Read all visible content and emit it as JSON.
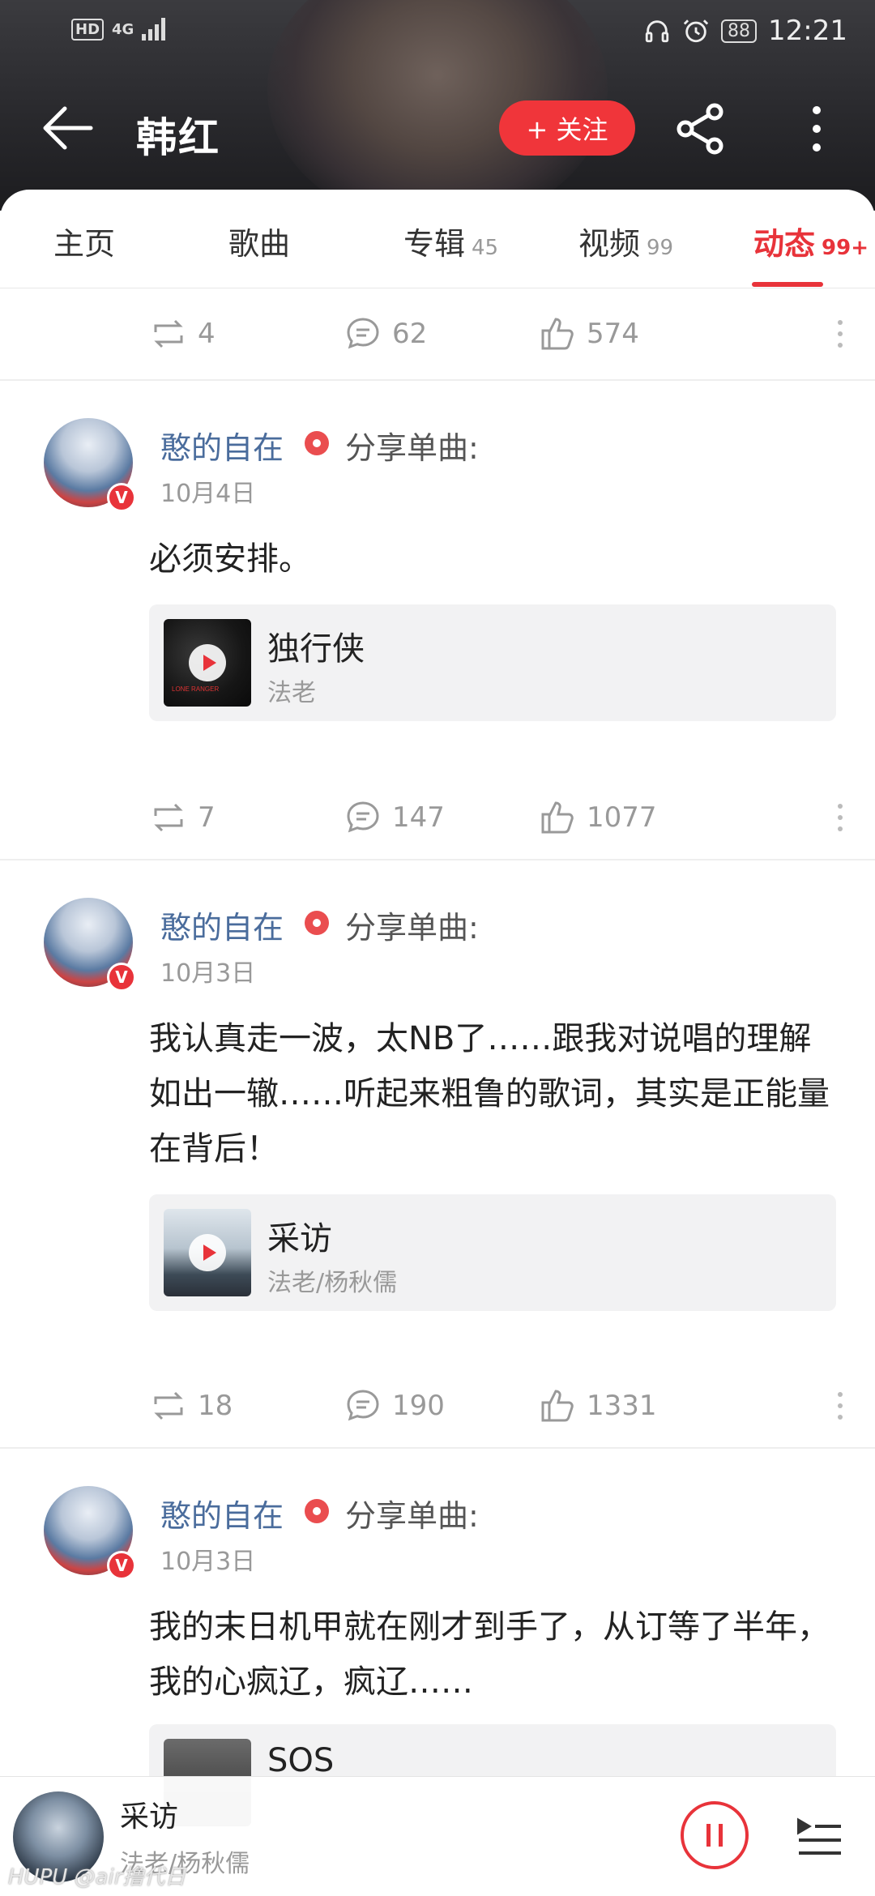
{
  "status": {
    "network": "HD",
    "signal": "4G",
    "battery": "88",
    "time": "12:21"
  },
  "header": {
    "title": "韩红",
    "follow_label": "+ 关注"
  },
  "tabs": [
    {
      "label": "主页",
      "count": ""
    },
    {
      "label": "歌曲",
      "count": ""
    },
    {
      "label": "专辑",
      "count": "45"
    },
    {
      "label": "视频",
      "count": "99"
    },
    {
      "label": "动态",
      "count": "99+"
    }
  ],
  "top_actions": {
    "repost": "4",
    "comment": "62",
    "like": "574"
  },
  "posts": [
    {
      "user": "憨的自在",
      "share_label": "分享单曲:",
      "date": "10月4日",
      "text": "必须安排。",
      "song": {
        "title": "独行侠",
        "artist": "法老",
        "cover_text": "LONE RANGER"
      },
      "repost": "7",
      "comment": "147",
      "like": "1077"
    },
    {
      "user": "憨的自在",
      "share_label": "分享单曲:",
      "date": "10月3日",
      "text": "我认真走一波，太NB了……跟我对说唱的理解如出一辙……听起来粗鲁的歌词，其实是正能量在背后！",
      "song": {
        "title": "采访",
        "artist": "法老/杨秋儒"
      },
      "repost": "18",
      "comment": "190",
      "like": "1331"
    },
    {
      "user": "憨的自在",
      "share_label": "分享单曲:",
      "date": "10月3日",
      "text": "我的末日机甲就在刚才到手了，从订等了半年，我的心疯辽，疯辽……",
      "song": {
        "title": "SOS",
        "artist": ""
      }
    }
  ],
  "player": {
    "title": "采访",
    "artist": "法老/杨秋儒"
  },
  "watermark": "HUPU @air撸代日",
  "colors": {
    "accent": "#e8333a",
    "username": "#4a6c9c"
  }
}
